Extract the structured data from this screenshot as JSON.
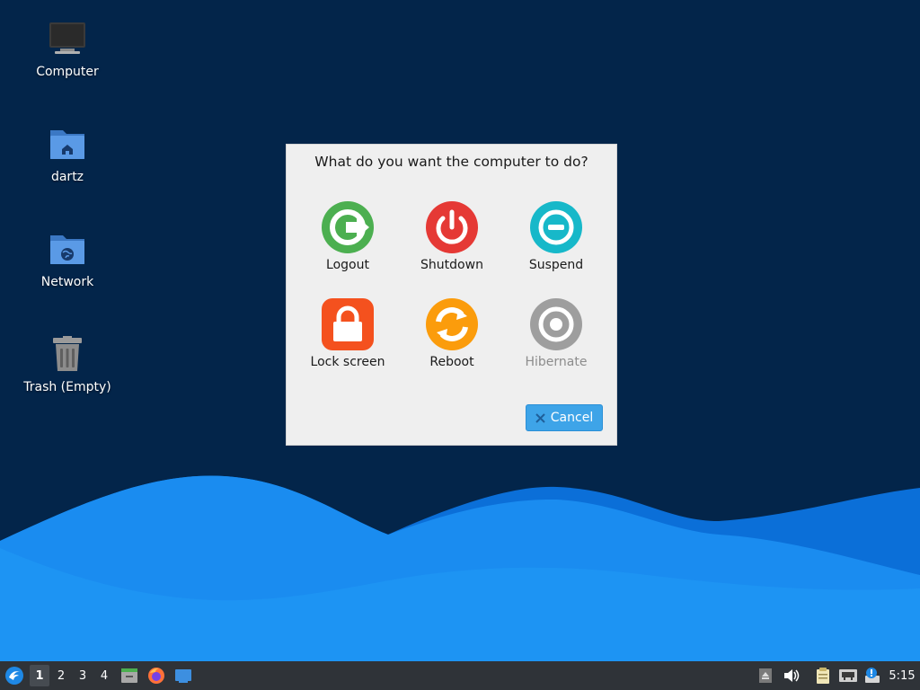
{
  "desktop": {
    "icons": [
      {
        "label": "Computer",
        "icon": "computer-icon"
      },
      {
        "label": "dartz",
        "icon": "home-folder-icon"
      },
      {
        "label": "Network",
        "icon": "network-folder-icon"
      },
      {
        "label": "Trash (Empty)",
        "icon": "trash-icon"
      }
    ],
    "colors": {
      "background": "#03254a",
      "wave_light": "#1a8cf0",
      "wave_mid": "#0b6fd8"
    }
  },
  "dialog": {
    "title": "What do you want the computer to do?",
    "actions": [
      {
        "label": "Logout",
        "icon": "logout-icon",
        "color": "#4caf50",
        "enabled": true
      },
      {
        "label": "Shutdown",
        "icon": "power-icon",
        "color": "#e53935",
        "enabled": true
      },
      {
        "label": "Suspend",
        "icon": "suspend-icon",
        "color": "#17b8c9",
        "enabled": true
      },
      {
        "label": "Lock screen",
        "icon": "lock-icon",
        "color": "#f4511e",
        "enabled": true
      },
      {
        "label": "Reboot",
        "icon": "reboot-icon",
        "color": "#fb9c0c",
        "enabled": true
      },
      {
        "label": "Hibernate",
        "icon": "hibernate-icon",
        "color": "#9e9e9e",
        "enabled": false
      }
    ],
    "cancel_label": "Cancel"
  },
  "taskbar": {
    "workspaces": [
      "1",
      "2",
      "3",
      "4"
    ],
    "active_workspace": "1",
    "launchers": [
      "file-manager-icon",
      "firefox-icon",
      "show-desktop-icon"
    ],
    "tray": [
      "eject-icon",
      "volume-icon",
      "clipboard-icon",
      "network-wired-icon",
      "notification-icon"
    ],
    "clock": "5:15"
  }
}
